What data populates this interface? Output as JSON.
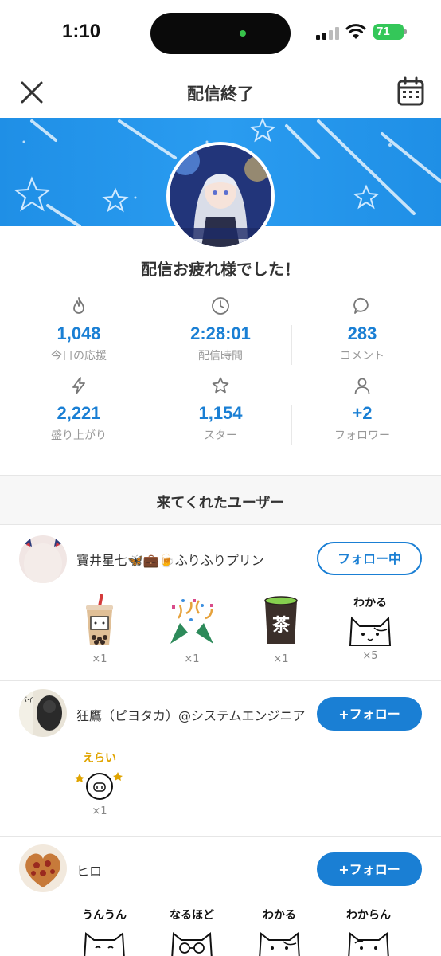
{
  "status_bar": {
    "time": "1:10",
    "battery": "71"
  },
  "header": {
    "title": "配信終了"
  },
  "greeting": "配信お疲れ様でした！",
  "stats": [
    {
      "icon": "flame-icon",
      "value": "1,048",
      "label": "今日の応援"
    },
    {
      "icon": "clock-icon",
      "value": "2:28:01",
      "label": "配信時間"
    },
    {
      "icon": "comment-icon",
      "value": "283",
      "label": "コメント"
    },
    {
      "icon": "lightning-icon",
      "value": "2,221",
      "label": "盛り上がり"
    },
    {
      "icon": "star-icon",
      "value": "1,154",
      "label": "スター"
    },
    {
      "icon": "person-icon",
      "value": "+2",
      "label": "フォロワー"
    }
  ],
  "section_title": "来てくれたユーザー",
  "users": [
    {
      "name": "寶井星七🦋💼🍺ふりふりプリン",
      "follow_label": "フォロー中",
      "gifts": [
        {
          "icon": "bubble-tea-icon",
          "count": "×1"
        },
        {
          "icon": "party-popper-icon",
          "count": "×1"
        },
        {
          "icon": "green-tea-cup-icon",
          "count": "×1",
          "text": "茶"
        },
        {
          "icon": "cat-wakaru-icon",
          "count": "×5",
          "text": "わかる"
        }
      ]
    },
    {
      "name": "狂鷹（ピヨタカ）@システムエンジニア",
      "follow_label": "+フォロー",
      "gifts": [
        {
          "icon": "pig-erai-icon",
          "count": "×1",
          "text": "えらい"
        }
      ]
    },
    {
      "name": "ヒロ",
      "follow_label": "+フォロー",
      "gifts": [
        {
          "icon": "cat-unun-icon",
          "text": "うんうん"
        },
        {
          "icon": "cat-naruhodo-icon",
          "text": "なるほど"
        },
        {
          "icon": "cat-wakaru-icon",
          "text": "わかる"
        },
        {
          "icon": "cat-wakaran-icon",
          "text": "わからん"
        }
      ]
    }
  ],
  "colors": {
    "accent": "#1a7fd4",
    "banner": "#2a9cf0",
    "battery": "#34c759"
  }
}
